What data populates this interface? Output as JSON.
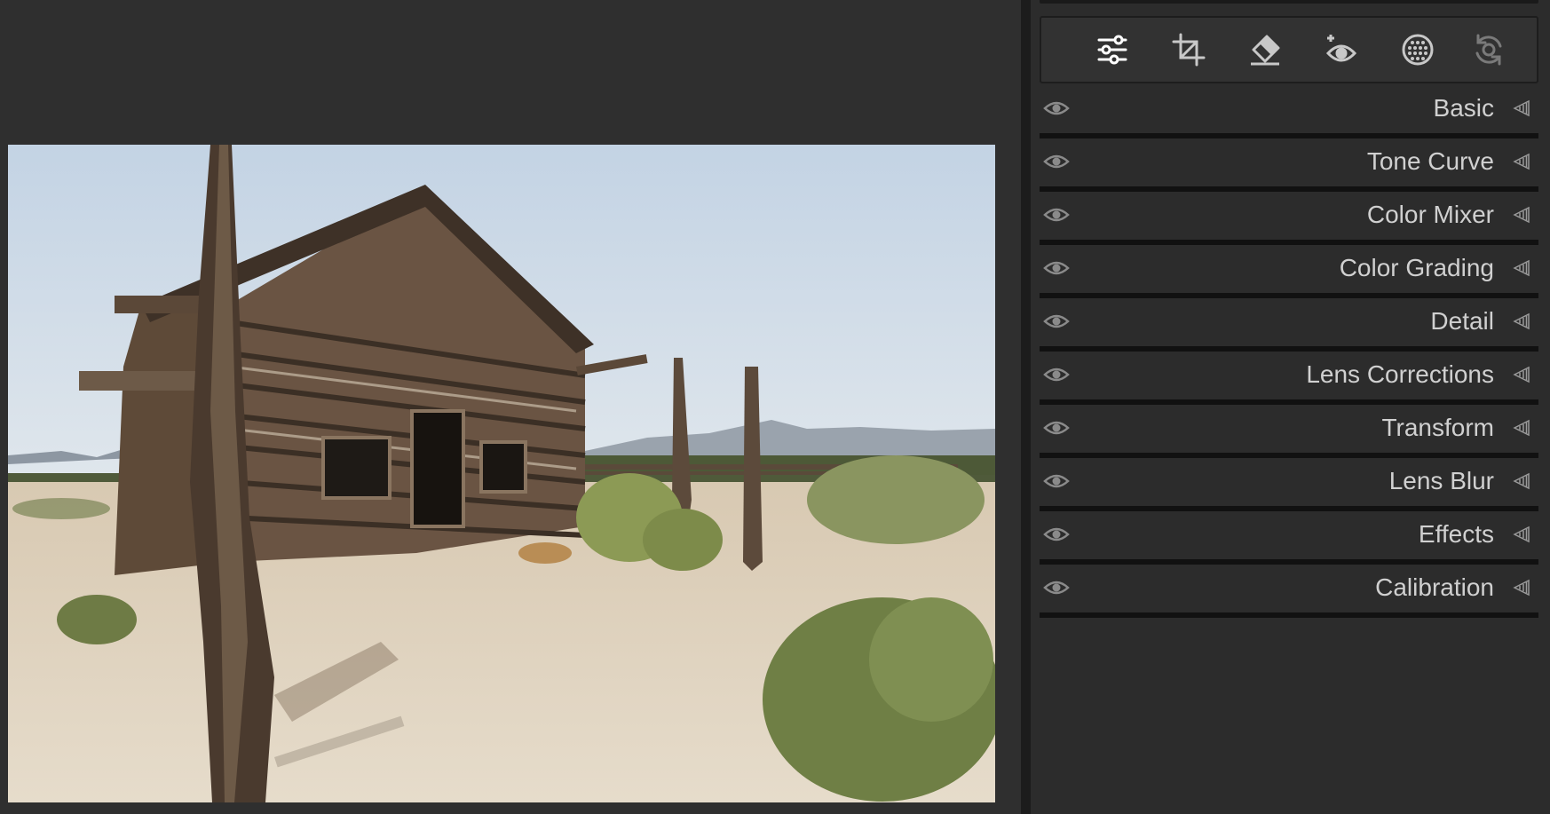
{
  "toolbar": {
    "tools": [
      {
        "name": "edit-sliders",
        "icon": "sliders-icon",
        "active": true
      },
      {
        "name": "crop",
        "icon": "crop-icon",
        "active": false
      },
      {
        "name": "remove",
        "icon": "eraser-icon",
        "active": false
      },
      {
        "name": "red-eye",
        "icon": "red-eye-icon",
        "active": false
      },
      {
        "name": "masking",
        "icon": "mask-circle-icon",
        "active": false
      },
      {
        "name": "presets",
        "icon": "sync-arrows-icon",
        "active": false
      }
    ]
  },
  "sections": [
    {
      "label": "Basic"
    },
    {
      "label": "Tone Curve"
    },
    {
      "label": "Color Mixer"
    },
    {
      "label": "Color Grading"
    },
    {
      "label": "Detail"
    },
    {
      "label": "Lens Corrections"
    },
    {
      "label": "Transform"
    },
    {
      "label": "Lens Blur"
    },
    {
      "label": "Effects"
    },
    {
      "label": "Calibration"
    }
  ],
  "colors": {
    "panel_bg": "#2c2c2c",
    "label_text": "#d0d0d0",
    "icon_active": "#ffffff",
    "icon_inactive": "#c8c8c8",
    "icon_dim": "#7a7a7a"
  }
}
